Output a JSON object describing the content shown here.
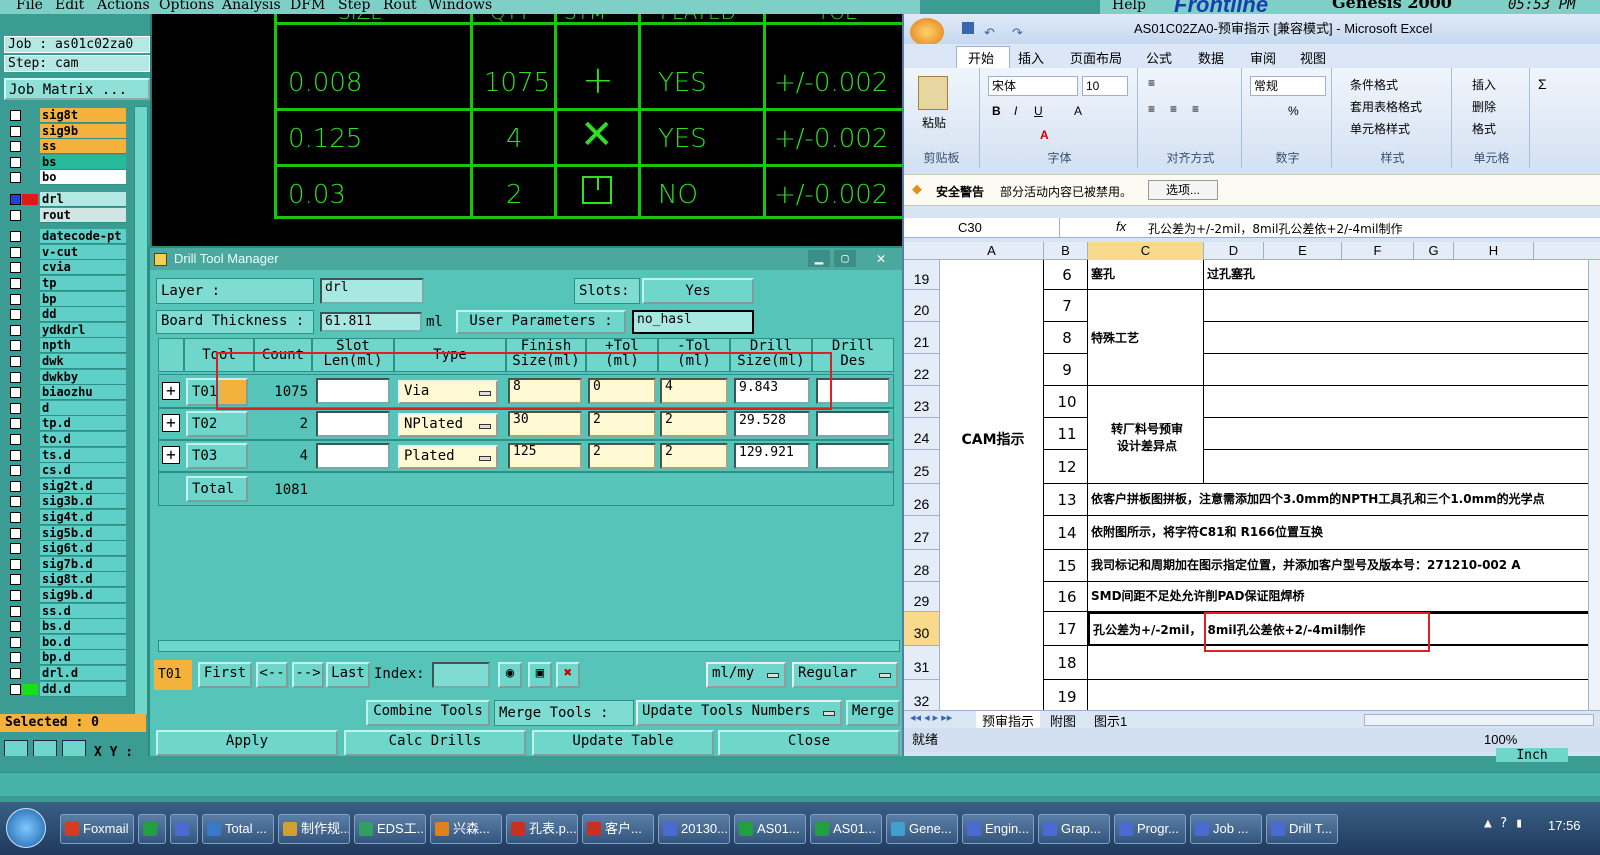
{
  "menubar": {
    "items": [
      "File",
      "Edit",
      "Actions",
      "Options",
      "Analysis",
      "DFM",
      "Step",
      "Rout",
      "Windows"
    ],
    "help": "Help",
    "brand": "Frontline",
    "genesis": "Genesis 2000",
    "time": "05:53 PM"
  },
  "left": {
    "job": "Job : as01c02za0",
    "step": "Step: cam",
    "matrix": "Job Matrix ...",
    "selected": "Selected : 0",
    "xy": "X Y :",
    "layers": [
      {
        "n": "sig8t",
        "c": "#f4b23c"
      },
      {
        "n": "sig9b",
        "c": "#f4b23c"
      },
      {
        "n": "ss",
        "c": "#f4b23c"
      },
      {
        "n": "bs",
        "c": "#28b89a"
      },
      {
        "n": "bo",
        "c": "#ffffff"
      },
      {
        "n": "drl",
        "c": "#b4e8e2"
      },
      {
        "n": "rout",
        "c": "#cfe6e4"
      },
      {
        "n": "datecode-pt",
        "c": "#5ed0c7"
      },
      {
        "n": "v-cut",
        "c": "#5ed0c7"
      },
      {
        "n": "cvia",
        "c": "#5ed0c7"
      },
      {
        "n": "tp",
        "c": "#5ed0c7"
      },
      {
        "n": "bp",
        "c": "#5ed0c7"
      },
      {
        "n": "dd",
        "c": "#5ed0c7"
      },
      {
        "n": "ydkdrl",
        "c": "#5ed0c7"
      },
      {
        "n": "npth",
        "c": "#5ed0c7"
      },
      {
        "n": "dwk",
        "c": "#5ed0c7"
      },
      {
        "n": "dwkby",
        "c": "#5ed0c7"
      },
      {
        "n": "biaozhu",
        "c": "#5ed0c7"
      },
      {
        "n": "d",
        "c": "#5ed0c7"
      },
      {
        "n": "tp.d",
        "c": "#5ed0c7"
      },
      {
        "n": "to.d",
        "c": "#5ed0c7"
      },
      {
        "n": "ts.d",
        "c": "#5ed0c7"
      },
      {
        "n": "cs.d",
        "c": "#5ed0c7"
      },
      {
        "n": "sig2t.d",
        "c": "#5ed0c7"
      },
      {
        "n": "sig3b.d",
        "c": "#5ed0c7"
      },
      {
        "n": "sig4t.d",
        "c": "#5ed0c7"
      },
      {
        "n": "sig5b.d",
        "c": "#5ed0c7"
      },
      {
        "n": "sig6t.d",
        "c": "#5ed0c7"
      },
      {
        "n": "sig7b.d",
        "c": "#5ed0c7"
      },
      {
        "n": "sig8t.d",
        "c": "#5ed0c7"
      },
      {
        "n": "sig9b.d",
        "c": "#5ed0c7"
      },
      {
        "n": "ss.d",
        "c": "#5ed0c7"
      },
      {
        "n": "bs.d",
        "c": "#5ed0c7"
      },
      {
        "n": "bo.d",
        "c": "#5ed0c7"
      },
      {
        "n": "bp.d",
        "c": "#5ed0c7"
      },
      {
        "n": "drl.d",
        "c": "#5ed0c7"
      },
      {
        "n": "dd.d",
        "c": "#5ed0c7"
      }
    ]
  },
  "drawing": {
    "headers": [
      "SIZE",
      "QTY",
      "SYM",
      "PLATED",
      "TOL"
    ],
    "rows": [
      [
        "0.008",
        "1075",
        "+",
        "YES",
        "+/-0.002"
      ],
      [
        "0.125",
        "4",
        "x",
        "YES",
        "+/-0.002"
      ],
      [
        "0.03",
        "2",
        "slot",
        "NO",
        "+/-0.002"
      ]
    ]
  },
  "dtm": {
    "title": "Drill Tool Manager",
    "layer_label": "Layer          :",
    "layer_value": "drl",
    "slots_label": "Slots:",
    "slots_value": "Yes",
    "thick_label": "Board Thickness :",
    "thick_value": "61.811",
    "thick_unit": "ml",
    "userparam_label": "User Parameters :",
    "userparam_value": "no_hasl",
    "headers": {
      "tool": "Tool",
      "count": "Count",
      "slot1": "Slot",
      "slot2": "Len(ml)",
      "type": "Type",
      "fin1": "Finish",
      "fin2": "Size(ml)",
      "ptol1": "+Tol",
      "ptol2": "(ml)",
      "ntol1": "-Tol",
      "ntol2": "(ml)",
      "drill1": "Drill",
      "drill2": "Size(ml)",
      "des1": "Drill",
      "des2": "Des"
    },
    "rows": [
      {
        "tool": "T01",
        "count": "1075",
        "type": "Via",
        "finish": "8",
        "ptol": "0",
        "ntol": "4",
        "drill": "9.843"
      },
      {
        "tool": "T02",
        "count": "2",
        "type": "NPlated",
        "finish": "30",
        "ptol": "2",
        "ntol": "2",
        "drill": "29.528"
      },
      {
        "tool": "T03",
        "count": "4",
        "type": "Plated",
        "finish": "125",
        "ptol": "2",
        "ntol": "2",
        "drill": "129.921"
      }
    ],
    "total_label": "Total",
    "total_value": "1081",
    "nav": {
      "cur": "T01",
      "first": "First",
      "prev": "<--",
      "next": "-->",
      "last": "Last",
      "index": "Index:",
      "units": "ml/my",
      "mode": "Regular"
    },
    "buttons": {
      "combine": "Combine Tools",
      "merge_label": "Merge Tools :",
      "update_nums": "Update Tools Numbers",
      "merge": "Merge",
      "apply": "Apply",
      "calc": "Calc Drills",
      "update_table": "Update Table",
      "close": "Close"
    }
  },
  "excel": {
    "title": "AS01C02ZA0-预审指示 [兼容模式] - Microsoft Excel",
    "tabs": [
      "开始",
      "插入",
      "页面布局",
      "公式",
      "数据",
      "审阅",
      "视图"
    ],
    "ribbon": {
      "paste": "粘贴",
      "clipboard": "剪贴板",
      "font": "宋体",
      "size": "10",
      "font_grp": "字体",
      "align_grp": "对齐方式",
      "numfmt": "常规",
      "num_grp": "数字",
      "cond": "条件格式",
      "tablefmt": "套用表格格式",
      "cellstyle": "单元格样式",
      "style_grp": "样式",
      "insert": "插入",
      "delete": "删除",
      "format": "格式",
      "cells_grp": "单元格"
    },
    "security": "安全警告",
    "security_msg": "部分活动内容已被禁用。",
    "options": "选项...",
    "namebox": "C30",
    "fx": "fx",
    "formula": "孔公差为+/-2mil，8mil孔公差依+2/-4mil制作",
    "cols": [
      "A",
      "B",
      "C",
      "D",
      "E",
      "F",
      "G",
      "H"
    ],
    "rownums": [
      "19",
      "20",
      "21",
      "22",
      "23",
      "24",
      "25",
      "26",
      "27",
      "28",
      "29",
      "30",
      "31",
      "32"
    ],
    "b": [
      "6",
      "7",
      "8",
      "9",
      "10",
      "11",
      "12",
      "13",
      "14",
      "15",
      "16",
      "17",
      "18",
      "19"
    ],
    "cam": "CAM指示",
    "saikong": "塞孔",
    "guokong": "过孔塞孔",
    "special": "特殊工艺",
    "zhuan": "转厂料号预审",
    "zhuan2": "设计差异点",
    "r13": "依客户拼板图拼板，注意需添加四个3.0mm的NPTH工具孔和三个1.0mm的光学点",
    "r14": "依附图所示，将字符C81和 R166位置互换",
    "r15": "我司标记和周期加在图示指定位置，并添加客户型号及版本号：271210-002 A",
    "r16": "SMD间距不足处允许削PAD保证阻焊桥",
    "r17a": "孔公差为+/-2mil，",
    "r17b": "8mil孔公差依+2/-4mil制作",
    "sheets": [
      "预审指示",
      "附图",
      "图示1"
    ],
    "status": "就绪",
    "zoom": "100%"
  },
  "gen_bottom": {
    "inch": "Inch"
  },
  "taskbar": {
    "items": [
      "Foxmail",
      "",
      "",
      "Total ...",
      "制作规...",
      "EDS工...",
      "兴森...",
      "孔表.p...",
      "客户...",
      "20130...",
      "AS01...",
      "AS01...",
      "Gene...",
      "Engin...",
      "Grap...",
      "Progr...",
      "Job ...",
      "Drill T..."
    ],
    "clock": "17:56"
  }
}
